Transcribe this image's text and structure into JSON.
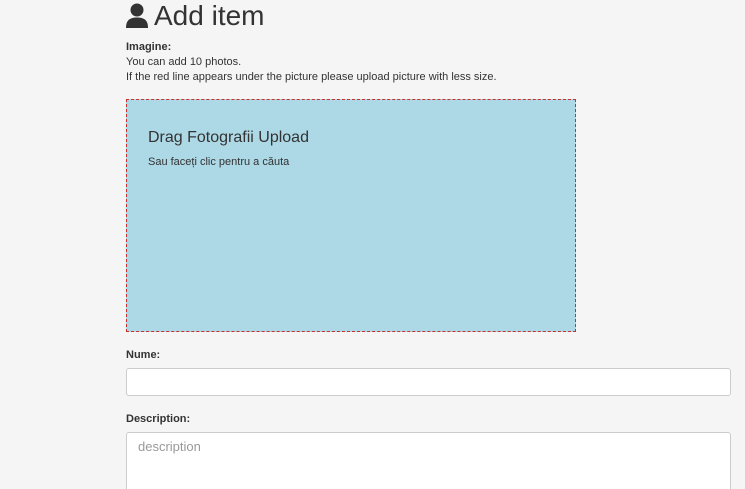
{
  "header": {
    "title": "Add item",
    "icon": "user-icon"
  },
  "images_section": {
    "label": "Imagine:",
    "hint_line_1": "You can add 10 photos.",
    "hint_line_2": "If the red line appears under the picture please upload picture with less size."
  },
  "dropzone": {
    "title": "Drag Fotografii Upload",
    "subtitle": "Sau faceți clic pentru a căuta",
    "background_color": "#add8e6",
    "border_color": "#c9302c"
  },
  "name_field": {
    "label": "Nume:",
    "value": "",
    "placeholder": ""
  },
  "description_field": {
    "label": "Description:",
    "value": "",
    "placeholder": "description"
  }
}
